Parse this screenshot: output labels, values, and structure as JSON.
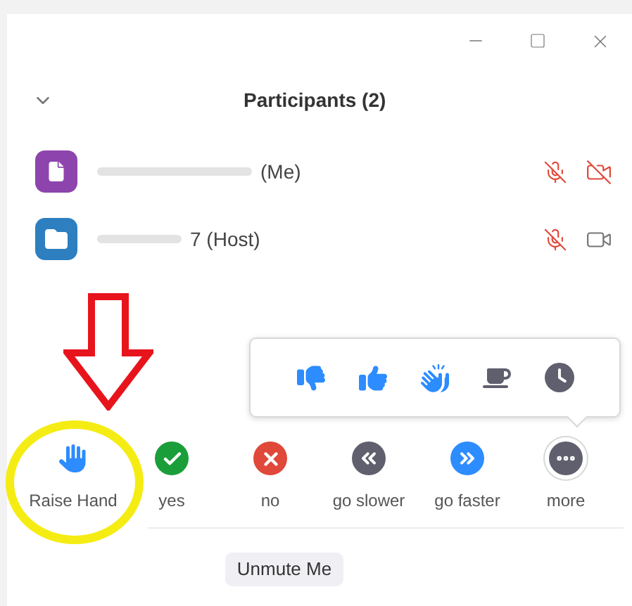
{
  "window": {
    "controls": [
      {
        "kind": "minimize"
      },
      {
        "kind": "maximize"
      },
      {
        "kind": "close"
      }
    ]
  },
  "header": {
    "title": "Participants (2)",
    "collapsed": false
  },
  "participants": [
    {
      "name": "(Me)",
      "color": "#8e44ad",
      "kind": "file",
      "mic_muted": true,
      "video_off": true
    },
    {
      "name": "7 (Host)",
      "color": "#2d7fc0",
      "kind": "folder",
      "mic_muted": true,
      "video_off": false
    }
  ],
  "reactions": [
    {
      "kind": "thumbs-down"
    },
    {
      "kind": "thumbs-up"
    },
    {
      "kind": "clap"
    },
    {
      "kind": "coffee"
    },
    {
      "kind": "clock"
    }
  ],
  "feedback": [
    {
      "kind": "hand",
      "label": "Raise Hand",
      "color": "#2d8cff",
      "selected": false
    },
    {
      "kind": "yes",
      "label": "yes",
      "color": "#1a9e3a",
      "selected": false
    },
    {
      "kind": "no",
      "label": "no",
      "color": "#e0483a",
      "selected": false
    },
    {
      "kind": "slower",
      "label": "go slower",
      "color": "#5f5f6e",
      "selected": false
    },
    {
      "kind": "faster",
      "label": "go faster",
      "color": "#2d8cff",
      "selected": false
    },
    {
      "kind": "more",
      "label": "more",
      "color": "#5f5f6e",
      "selected": true
    }
  ],
  "unmute_button": "Unmute Me"
}
